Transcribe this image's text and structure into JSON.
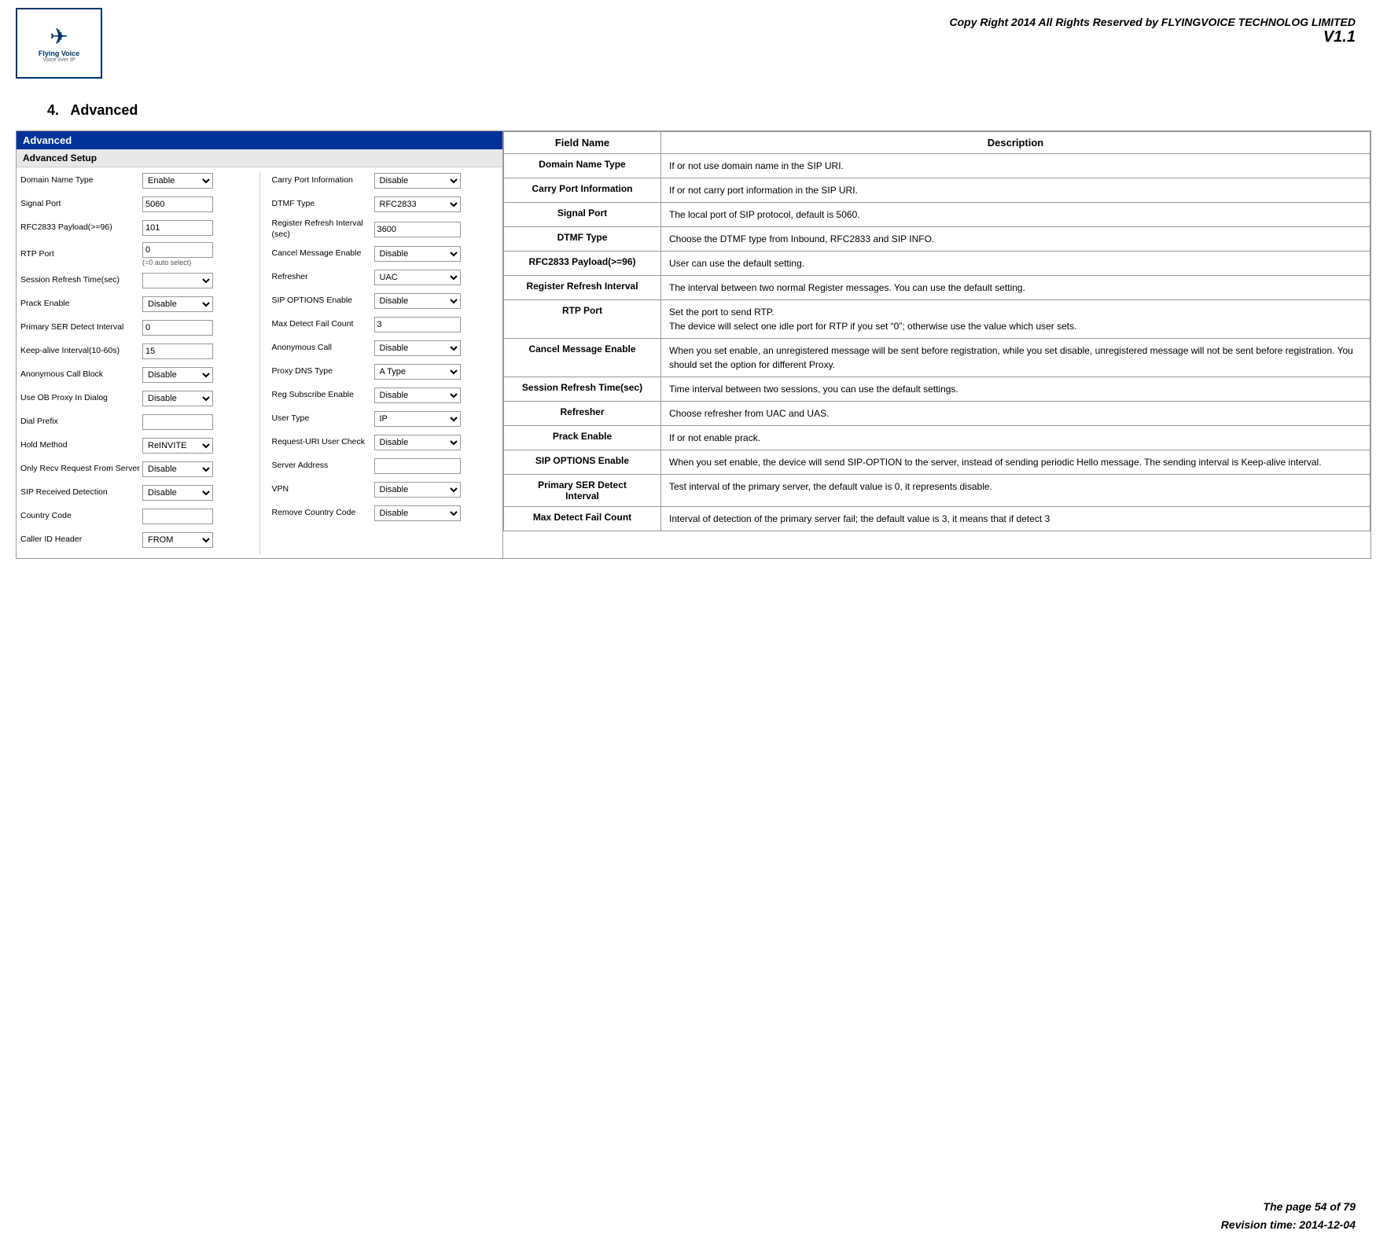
{
  "header": {
    "logo_text": "Flying Voice",
    "logo_sub": "Voice over IP",
    "copyright": "Copy Right 2014 All Rights Reserved by FLYINGVOICE TECHNOLOG LIMITED",
    "version": "V1.1"
  },
  "section": {
    "number": "4.",
    "title": "Advanced"
  },
  "left_panel": {
    "header": "Advanced",
    "section_title": "Advanced Setup",
    "col_left": {
      "rows": [
        {
          "label": "Domain Name Type",
          "control": "select",
          "value": "Enable"
        },
        {
          "label": "Signal Port",
          "control": "input",
          "value": "5060"
        },
        {
          "label": "RFC2833 Payload(>=96)",
          "control": "input",
          "value": "101"
        },
        {
          "label": "RTP Port",
          "control": "input",
          "value": "0",
          "sub": "(=0 auto select)"
        },
        {
          "label": "Session Refresh Time(sec)",
          "control": "select",
          "value": ""
        },
        {
          "label": "Prack Enable",
          "control": "select",
          "value": "Disable"
        },
        {
          "label": "Primary SER Detect Interval",
          "control": "input",
          "value": "0"
        },
        {
          "label": "Keep-alive Interval(10-60s)",
          "control": "input",
          "value": "15"
        },
        {
          "label": "Anonymous Call Block",
          "control": "select",
          "value": "Disable"
        },
        {
          "label": "Use OB Proxy In Dialog",
          "control": "select",
          "value": "Disable"
        },
        {
          "label": "Dial Prefix",
          "control": "input",
          "value": ""
        },
        {
          "label": "Hold Method",
          "control": "select",
          "value": "ReINVITE"
        },
        {
          "label": "Only Recv Request From Server",
          "control": "select",
          "value": "Disable"
        },
        {
          "label": "SIP Received Detection",
          "control": "select",
          "value": "Disable"
        },
        {
          "label": "Country Code",
          "control": "input",
          "value": ""
        },
        {
          "label": "Caller ID Header",
          "control": "select",
          "value": "FROM"
        }
      ]
    },
    "col_right": {
      "rows": [
        {
          "label": "Carry Port Information",
          "control": "select",
          "value": "Disable"
        },
        {
          "label": "DTMF Type",
          "control": "select",
          "value": "RFC2833"
        },
        {
          "label": "Register Refresh Interval (sec)",
          "control": "input",
          "value": "3600"
        },
        {
          "label": "Cancel Message Enable",
          "control": "select",
          "value": "Disable"
        },
        {
          "label": "Refresher",
          "control": "select",
          "value": "UAC"
        },
        {
          "label": "SIP OPTIONS Enable",
          "control": "select",
          "value": "Disable"
        },
        {
          "label": "Max Detect Fail Count",
          "control": "input",
          "value": "3"
        },
        {
          "label": "Anonymous Call",
          "control": "select",
          "value": "Disable"
        },
        {
          "label": "Proxy DNS Type",
          "control": "select",
          "value": "A Type"
        },
        {
          "label": "Reg Subscribe Enable",
          "control": "select",
          "value": "Disable"
        },
        {
          "label": "User Type",
          "control": "select",
          "value": "IP"
        },
        {
          "label": "Request-URI User Check",
          "control": "select",
          "value": "Disable"
        },
        {
          "label": "Server Address",
          "control": "input",
          "value": ""
        },
        {
          "label": "VPN",
          "control": "select",
          "value": "Disable"
        },
        {
          "label": "Remove Country Code",
          "control": "select",
          "value": "Disable"
        }
      ]
    }
  },
  "table": {
    "headers": [
      "Field Name",
      "Description"
    ],
    "rows": [
      {
        "field": "Domain Name Type",
        "description": "If or not use domain name in the SIP URI."
      },
      {
        "field": "Carry Port Information",
        "description": "If or not carry port information in the SIP URI."
      },
      {
        "field": "Signal Port",
        "description": "The local port of SIP protocol, default is 5060."
      },
      {
        "field": "DTMF Type",
        "description": "Choose the DTMF type from Inbound, RFC2833 and SIP INFO."
      },
      {
        "field": "RFC2833 Payload(>=96)",
        "description": "User can use the default setting."
      },
      {
        "field": "Register Refresh Interval",
        "description": "The interval between two normal Register messages. You can use the default setting."
      },
      {
        "field": "RTP Port",
        "description": "Set the port to send RTP.\nThe device will select one idle port for RTP if you set “0”; otherwise use the value which user sets."
      },
      {
        "field": "Cancel Message Enable",
        "description": "When you set enable, an unregistered message will be sent before registration, while you set disable, unregistered message will not be sent before registration. You should set the option for different Proxy."
      },
      {
        "field": "Session Refresh Time(sec)",
        "description": "Time interval between two sessions, you can use the default settings."
      },
      {
        "field": "Refresher",
        "description": "Choose refresher from UAC and UAS."
      },
      {
        "field": "Prack Enable",
        "description": "If or not enable prack."
      },
      {
        "field": "SIP OPTIONS Enable",
        "description": "When you set enable, the device will send SIP-OPTION to the server, instead of sending periodic Hello message. The sending interval is Keep-alive interval."
      },
      {
        "field": "Primary SER Detect\nInterval",
        "description": "Test interval of the primary server, the default value is 0, it represents disable."
      },
      {
        "field": "Max Detect Fail Count",
        "description": "Interval of detection of the primary server fail; the default value is 3, it means that if detect 3"
      }
    ]
  },
  "footer": {
    "line1": "The page 54 of 79",
    "line2": "Revision time: 2014-12-04"
  }
}
